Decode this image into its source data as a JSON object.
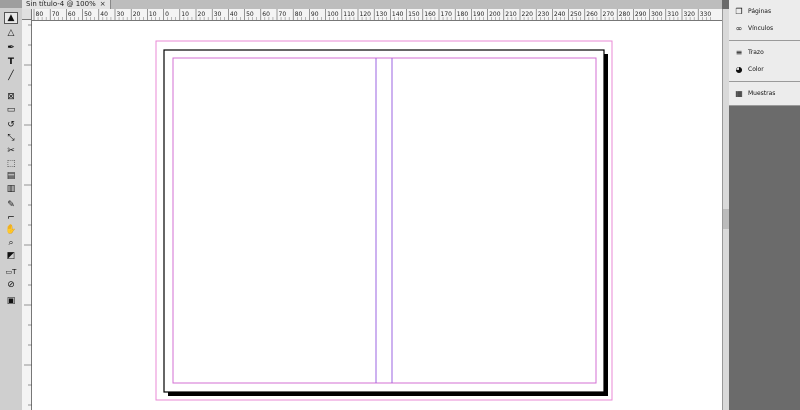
{
  "document": {
    "tab_title": "Sin título-4 @ 100%"
  },
  "ruler": {
    "ticks": [
      "80",
      "70",
      "60",
      "50",
      "40",
      "30",
      "20",
      "10",
      "0",
      "10",
      "20",
      "30",
      "40",
      "50",
      "60",
      "70",
      "80",
      "90",
      "100",
      "110",
      "120",
      "130",
      "140",
      "150",
      "160",
      "170",
      "180",
      "190",
      "200",
      "210",
      "220",
      "230",
      "240",
      "250",
      "260",
      "270",
      "280",
      "290",
      "300",
      "310",
      "320",
      "330"
    ]
  },
  "panel": {
    "group1": [
      {
        "label": "Páginas",
        "icon": "pages-icon"
      },
      {
        "label": "Vínculos",
        "icon": "links-icon"
      }
    ],
    "group2": [
      {
        "label": "Trazo",
        "icon": "stroke-icon"
      },
      {
        "label": "Color",
        "icon": "color-icon"
      }
    ],
    "group3": [
      {
        "label": "Muestras",
        "icon": "swatches-icon"
      }
    ]
  },
  "colors": {
    "margin_guide": "#d36fd3",
    "column_guide": "#9b63e0",
    "bleed_guide": "#e88ad6",
    "panel_bg": "#ececec",
    "pasteboard": "#ffffff",
    "app_bg": "#6b6b6b"
  },
  "tools": [
    "selection-icon",
    "direct-selection-icon",
    "pen-icon",
    "type-icon",
    "line-icon",
    "frame-icon",
    "rectangle-icon",
    "rotate-icon",
    "scale-icon",
    "scissors-icon",
    "free-transform-icon",
    "gradient-icon",
    "note-icon",
    "eyedropper-icon",
    "hand-icon",
    "zoom-icon",
    "fill-stroke-icon",
    "apply-none-icon",
    "view-mode-icon"
  ]
}
